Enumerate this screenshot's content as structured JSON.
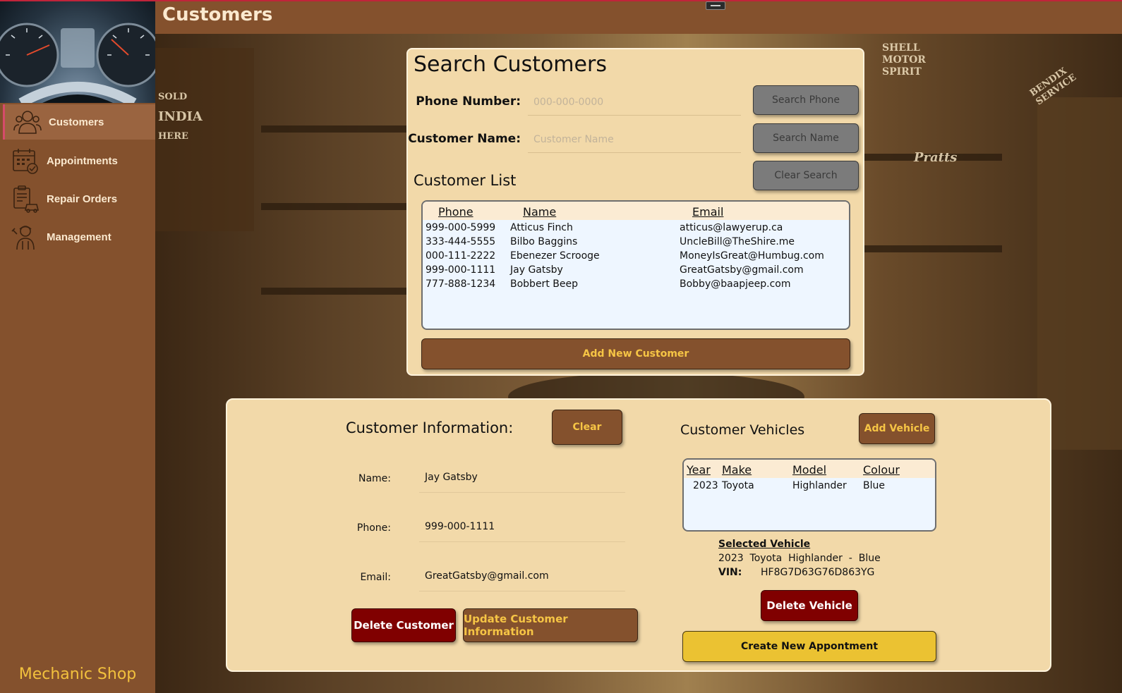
{
  "header": {
    "title": "Customers"
  },
  "sidebar": {
    "items": [
      {
        "label": "Customers",
        "icon": "customers-icon",
        "active": true
      },
      {
        "label": "Appointments",
        "icon": "calendar-icon",
        "active": false
      },
      {
        "label": "Repair Orders",
        "icon": "repair-order-icon",
        "active": false
      },
      {
        "label": "Management",
        "icon": "mechanic-icon",
        "active": false
      }
    ],
    "brand": "Mechanic Shop"
  },
  "search": {
    "title": "Search Customers",
    "phone_label": "Phone Number:",
    "phone_placeholder": "000-000-0000",
    "name_label": "Customer Name:",
    "name_placeholder": "Customer Name",
    "search_phone_btn": "Search Phone",
    "search_name_btn": "Search Name",
    "clear_search_btn": "Clear Search"
  },
  "customer_list": {
    "title": "Customer List",
    "columns": [
      "Phone",
      "Name",
      "Email"
    ],
    "rows": [
      {
        "phone": "999-000-5999",
        "name": "Atticus Finch",
        "email": "atticus@lawyerup.ca"
      },
      {
        "phone": "333-444-5555",
        "name": "Bilbo Baggins",
        "email": "UncleBill@TheShire.me"
      },
      {
        "phone": "000-111-2222",
        "name": "Ebenezer Scrooge",
        "email": "MoneyIsGreat@Humbug.com"
      },
      {
        "phone": "999-000-1111",
        "name": "Jay Gatsby",
        "email": "GreatGatsby@gmail.com"
      },
      {
        "phone": "777-888-1234",
        "name": "Bobbert Beep",
        "email": "Bobby@baapjeep.com"
      }
    ],
    "add_btn": "Add New Customer"
  },
  "customer_info": {
    "title": "Customer Information:",
    "clear_btn": "Clear",
    "name_label": "Name:",
    "name_value": "Jay Gatsby",
    "phone_label": "Phone:",
    "phone_value": "999-000-1111",
    "email_label": "Email:",
    "email_value": "GreatGatsby@gmail.com",
    "delete_btn": "Delete Customer",
    "update_btn": "Update Customer Information"
  },
  "vehicles": {
    "title": "Customer Vehicles",
    "add_btn": "Add Vehicle",
    "columns": [
      "Year",
      "Make",
      "Model",
      "Colour"
    ],
    "rows": [
      {
        "year": "2023",
        "make": "Toyota",
        "model": "Highlander",
        "colour": "Blue"
      }
    ],
    "selected_title": "Selected Vehicle",
    "selected_desc": "2023  Toyota  Highlander  -  Blue",
    "vin_label": "VIN:",
    "vin_value": "HF8G7D63G76D863YG",
    "delete_btn": "Delete Vehicle",
    "appointment_btn": "Create New Appontment"
  },
  "background_signs": {
    "shell": "SHELL MOTOR SPIRIT",
    "bendix": "BENDIX SERVICE",
    "pratts": "Pratts",
    "sold": "SOLD",
    "india": "INDIA",
    "here": "HERE"
  },
  "colors": {
    "sidebar": "#84512d",
    "panel": "#f2d9a9",
    "accent_gold": "#f6c545",
    "danger": "#800000",
    "cta_yellow": "#ebc232"
  }
}
